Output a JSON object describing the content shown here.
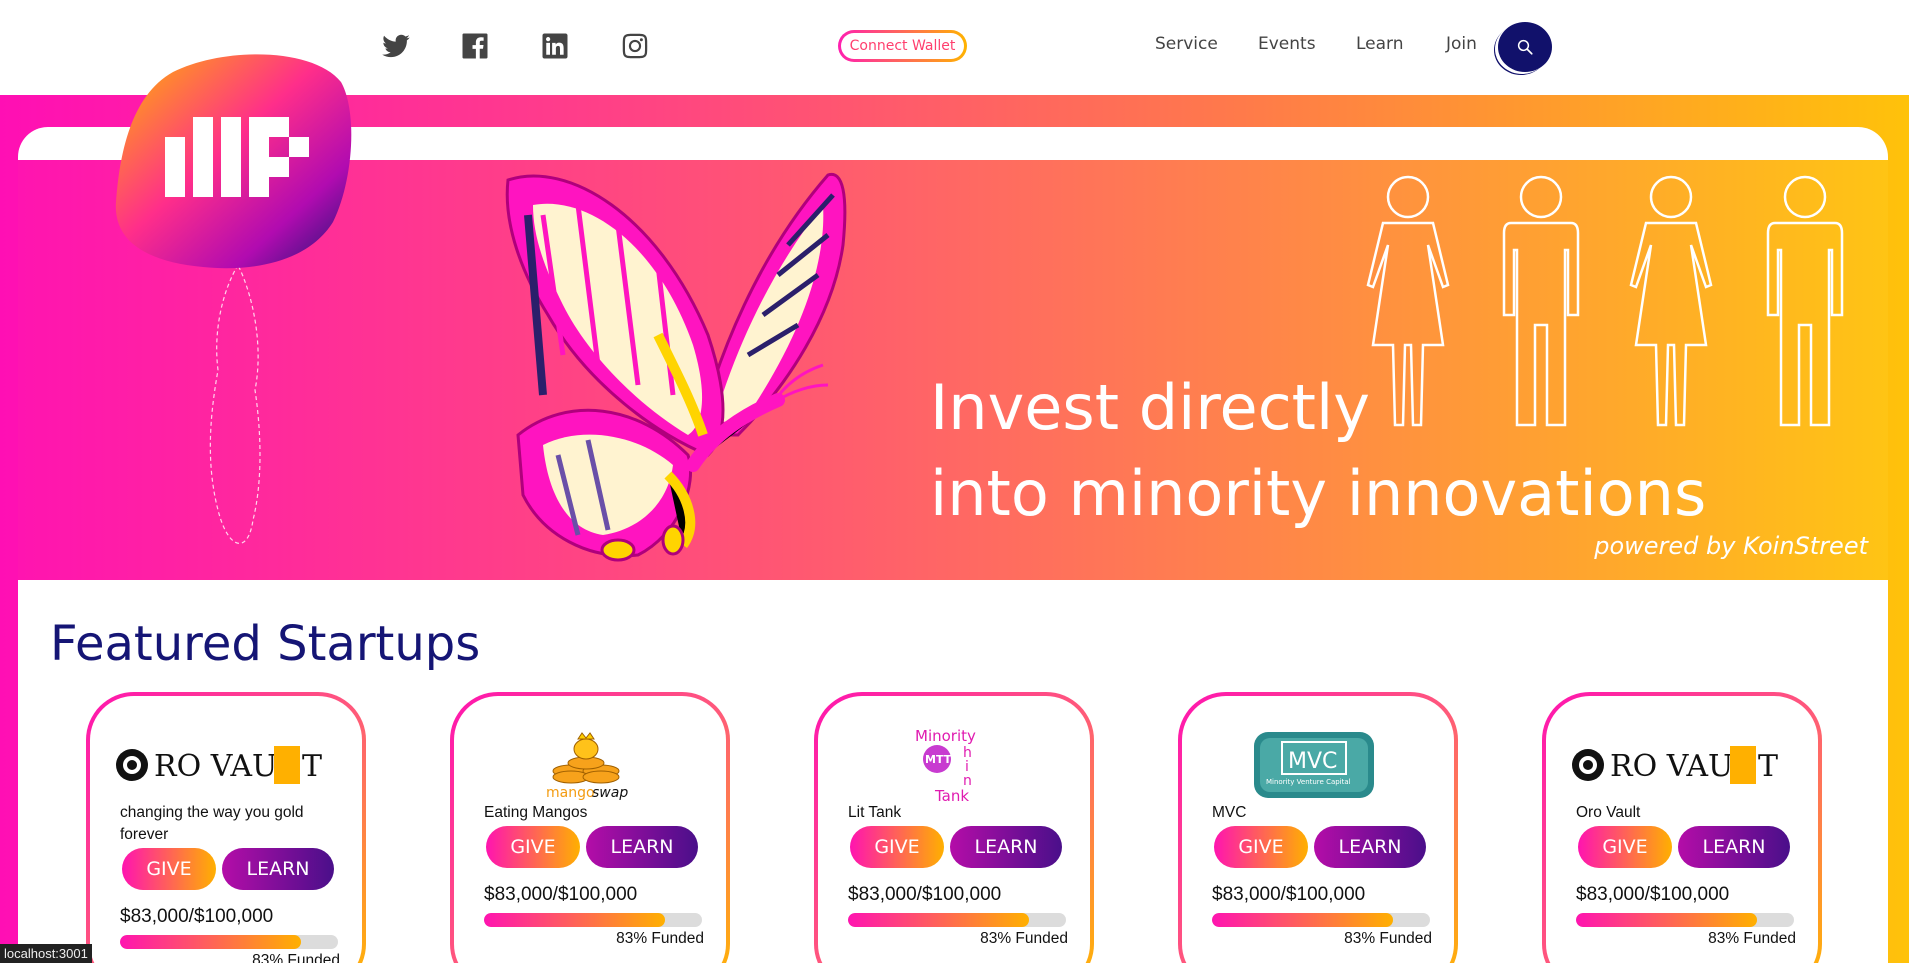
{
  "nav": {
    "social": [
      "twitter-icon",
      "facebook-icon",
      "linkedin-icon",
      "instagram-icon"
    ],
    "connect_wallet": "Connect Wallet",
    "links": [
      "Service",
      "Events",
      "Learn",
      "Join"
    ],
    "search_icon": "search-icon"
  },
  "hero": {
    "title_line1": "Invest directly",
    "title_line2": "into minority innovations",
    "powered": "powered by KoinStreet"
  },
  "featured": {
    "title": "Featured Startups",
    "cards": [
      {
        "logo_text": "ORO VAULT",
        "desc": "changing the way you gold forever",
        "give": "GIVE",
        "learn": "LEARN",
        "amount": "$83,000/$100,000",
        "progress": 0.83,
        "funded": "83% Funded"
      },
      {
        "logo_text": "mangoswap",
        "desc": "Eating Mangos",
        "give": "GIVE",
        "learn": "LEARN",
        "amount": "$83,000/$100,000",
        "progress": 0.83,
        "funded": "83% Funded"
      },
      {
        "logo_text": "Minority Think Tank",
        "desc": "Lit Tank",
        "give": "GIVE",
        "learn": "LEARN",
        "amount": "$83,000/$100,000",
        "progress": 0.83,
        "funded": "83% Funded"
      },
      {
        "logo_text": "MVC",
        "desc": "MVC",
        "give": "GIVE",
        "learn": "LEARN",
        "amount": "$83,000/$100,000",
        "progress": 0.83,
        "funded": "83% Funded"
      },
      {
        "logo_text": "ORO VAULT",
        "desc": "Oro Vault",
        "give": "GIVE",
        "learn": "LEARN",
        "amount": "$83,000/$100,000",
        "progress": 0.83,
        "funded": "83% Funded"
      }
    ]
  },
  "status_bar": "localhost:3001",
  "colors": {
    "brand_navy": "#151575",
    "pink": "#ff14b0",
    "orange": "#ffb000",
    "purple": "#4a0f8a"
  }
}
